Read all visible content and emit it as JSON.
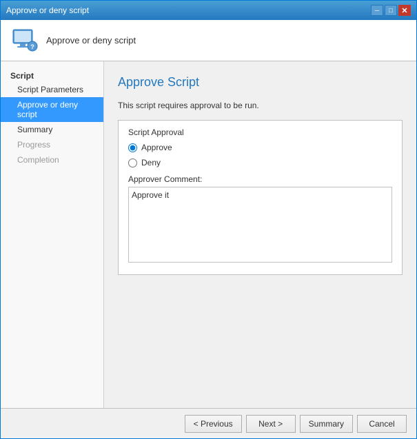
{
  "window": {
    "title": "Approve or deny script",
    "close_label": "✕",
    "minimize_label": "─",
    "maximize_label": "□"
  },
  "header": {
    "title": "Approve or deny script",
    "icon_alt": "computer-icon"
  },
  "sidebar": {
    "section_label": "Script",
    "items": [
      {
        "id": "script-parameters",
        "label": "Script Parameters",
        "state": "normal"
      },
      {
        "id": "approve-or-deny-script",
        "label": "Approve or deny script",
        "state": "active"
      },
      {
        "id": "summary",
        "label": "Summary",
        "state": "normal"
      },
      {
        "id": "progress",
        "label": "Progress",
        "state": "disabled"
      },
      {
        "id": "completion",
        "label": "Completion",
        "state": "disabled"
      }
    ]
  },
  "main": {
    "page_title": "Approve Script",
    "description": "This script requires approval to be run.",
    "group_label": "Script Approval",
    "radio_options": [
      {
        "id": "approve",
        "label": "Approve",
        "checked": true
      },
      {
        "id": "deny",
        "label": "Deny",
        "checked": false
      }
    ],
    "comment_label": "Approver Comment:",
    "comment_value": "Approve it"
  },
  "footer": {
    "buttons": [
      {
        "id": "previous",
        "label": "< Previous"
      },
      {
        "id": "next",
        "label": "Next >"
      },
      {
        "id": "summary",
        "label": "Summary"
      },
      {
        "id": "cancel",
        "label": "Cancel"
      }
    ]
  }
}
